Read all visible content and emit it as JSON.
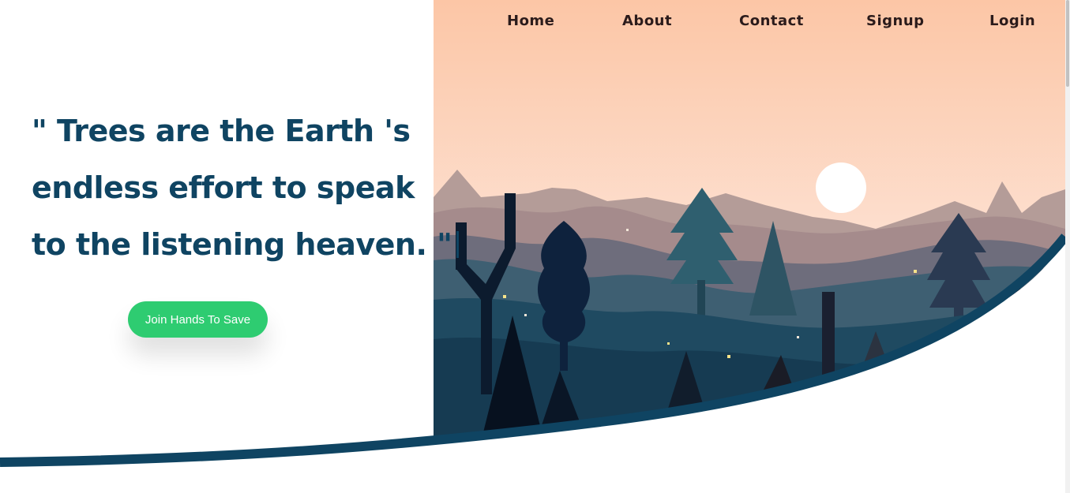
{
  "nav": {
    "items": [
      {
        "label": "Home"
      },
      {
        "label": "About"
      },
      {
        "label": "Contact"
      },
      {
        "label": "Signup"
      },
      {
        "label": "Login"
      }
    ]
  },
  "hero": {
    "quote_lines": [
      "\" Trees are the Earth 's",
      "endless effort to speak",
      "to the listening heaven. \""
    ],
    "cta_label": "Join Hands To Save"
  },
  "colors": {
    "accent": "#2ecc71",
    "heading": "#0f4462",
    "nav_text": "#2b1b1b",
    "sky_top": "#fcc8a8",
    "sky_bottom": "#fde3d6"
  },
  "illustration": "forest-sunset-illustration"
}
